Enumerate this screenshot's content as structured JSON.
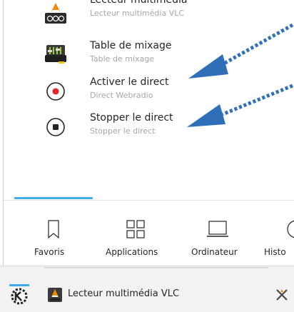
{
  "menu": {
    "items": [
      {
        "title": "Lecteur multimédia",
        "subtitle": "Lecteur multimédia VLC",
        "icon": "vlc-icon"
      },
      {
        "title": "Table de mixage",
        "subtitle": "Table de mixage",
        "icon": "mixer-icon"
      },
      {
        "title": "Activer le direct",
        "subtitle": "Direct Webradio",
        "icon": "record-icon"
      },
      {
        "title": "Stopper le direct",
        "subtitle": "Stopper le direct",
        "icon": "stop-icon"
      }
    ]
  },
  "tabs": [
    {
      "label": "Favoris",
      "icon": "bookmark-icon"
    },
    {
      "label": "Applications",
      "icon": "grid-icon"
    },
    {
      "label": "Ordinateur",
      "icon": "laptop-icon"
    },
    {
      "label": "Histo",
      "icon": "history-icon"
    }
  ],
  "taskbar": {
    "task_label": "Lecteur multimédia VLC"
  },
  "colors": {
    "accent": "#3daee9",
    "record_red": "#e0262c",
    "arrow_blue": "#2e6fb8"
  }
}
